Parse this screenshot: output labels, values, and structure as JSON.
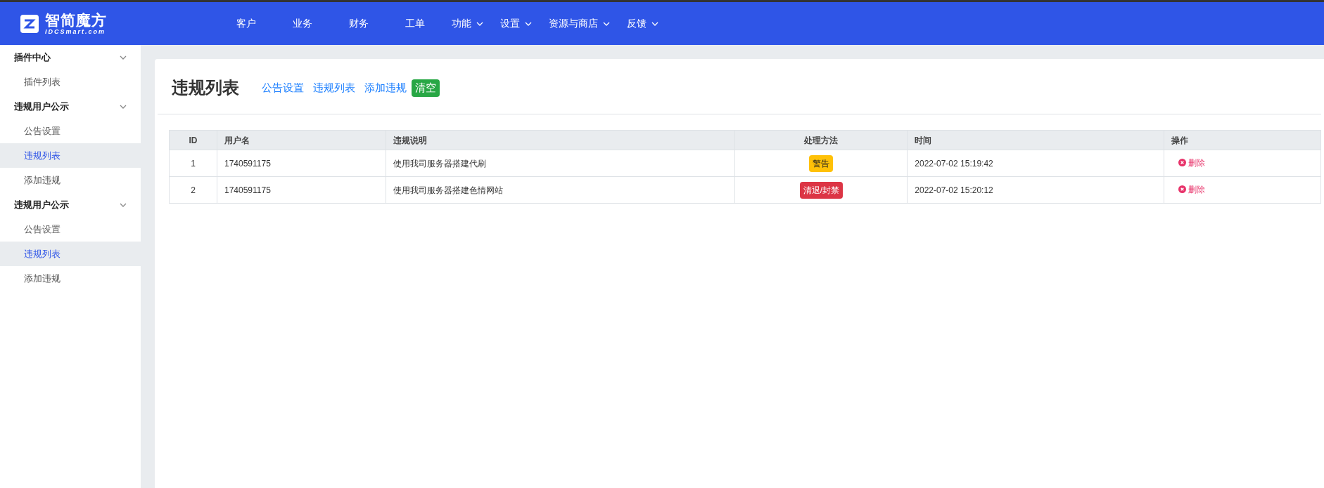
{
  "logo": {
    "name": "智简魔方",
    "subtitle": "IDCSmart.com"
  },
  "nav": [
    {
      "label": "客户",
      "dropdown": false
    },
    {
      "label": "业务",
      "dropdown": false
    },
    {
      "label": "财务",
      "dropdown": false
    },
    {
      "label": "工单",
      "dropdown": false
    },
    {
      "label": "功能",
      "dropdown": true
    },
    {
      "label": "设置",
      "dropdown": true
    },
    {
      "label": "资源与商店",
      "dropdown": true
    },
    {
      "label": "反馈",
      "dropdown": true
    }
  ],
  "sidebar": {
    "groups": [
      {
        "label": "插件中心",
        "expanded": true,
        "items": [
          {
            "label": "插件列表",
            "selected": false
          }
        ]
      },
      {
        "label": "违规用户公示",
        "expanded": true,
        "items": [
          {
            "label": "公告设置",
            "selected": false
          },
          {
            "label": "违规列表",
            "selected": true
          },
          {
            "label": "添加违规",
            "selected": false
          }
        ]
      },
      {
        "label": "违规用户公示",
        "expanded": true,
        "items": [
          {
            "label": "公告设置",
            "selected": false
          },
          {
            "label": "违规列表",
            "selected": true
          },
          {
            "label": "添加违规",
            "selected": false
          }
        ]
      }
    ]
  },
  "page": {
    "title": "违规列表",
    "links": [
      "公告设置",
      "违规列表",
      "添加违规"
    ],
    "clear_button": "清空"
  },
  "table": {
    "columns": [
      "ID",
      "用户名",
      "违规说明",
      "处理方法",
      "时间",
      "操作"
    ],
    "rows": [
      {
        "id": "1",
        "username": "1740591175",
        "description": "使用我司服务器搭建代刷",
        "method": {
          "label": "警告",
          "color": "#ffc107"
        },
        "time": "2022-07-02 15:19:42",
        "action": "删除"
      },
      {
        "id": "2",
        "username": "1740591175",
        "description": "使用我司服务器搭建色情网站",
        "method": {
          "label": "清退/封禁",
          "color": "#dc3545"
        },
        "time": "2022-07-02 15:20:12",
        "action": "删除"
      }
    ]
  }
}
